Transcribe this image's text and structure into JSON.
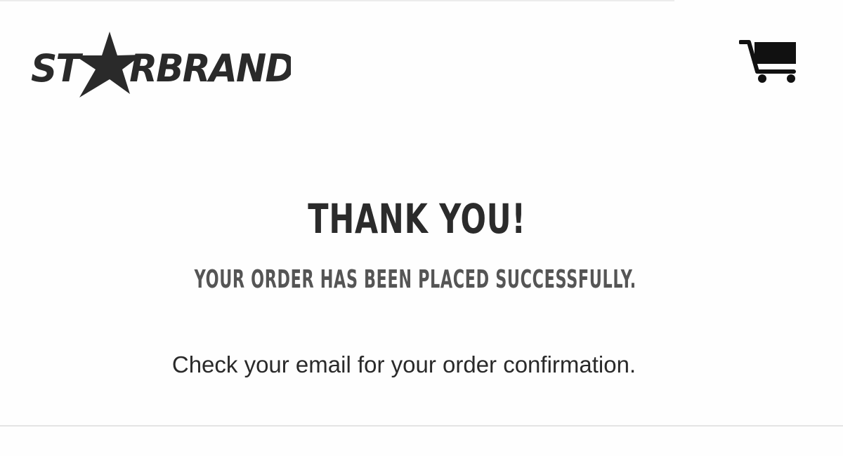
{
  "header": {
    "brand_name": "STARBRAND",
    "logo_icon": "star-icon",
    "cart_icon": "shopping-cart-icon"
  },
  "confirmation": {
    "headline": "THANK YOU!",
    "subheadline": "YOUR ORDER HAS BEEN PLACED SUCCESSFULLY.",
    "note": "Check your email for your order confirmation."
  },
  "colors": {
    "headline": "#2b2b2b",
    "subheadline": "#555555",
    "body_text": "#2a2a2a",
    "logo": "#2a2a2a",
    "divider": "#e4e4e4"
  }
}
